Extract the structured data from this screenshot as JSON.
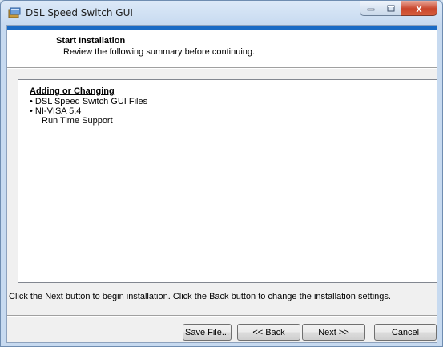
{
  "window": {
    "title": "DSL Speed Switch GUI",
    "close_glyph": "x",
    "accent_color": "#1a6bc5"
  },
  "header": {
    "title": "Start Installation",
    "subtitle": "Review the following summary before continuing."
  },
  "summary": {
    "heading": "Adding or Changing",
    "lines": [
      "• DSL Speed Switch GUI Files",
      "• NI-VISA 5.4",
      "Run Time Support"
    ]
  },
  "instructions": "Click the Next button to begin installation.  Click the Back button to change the installation settings.",
  "buttons": {
    "save": "Save File...",
    "back": "<< Back",
    "next": "Next >>",
    "cancel": "Cancel"
  }
}
